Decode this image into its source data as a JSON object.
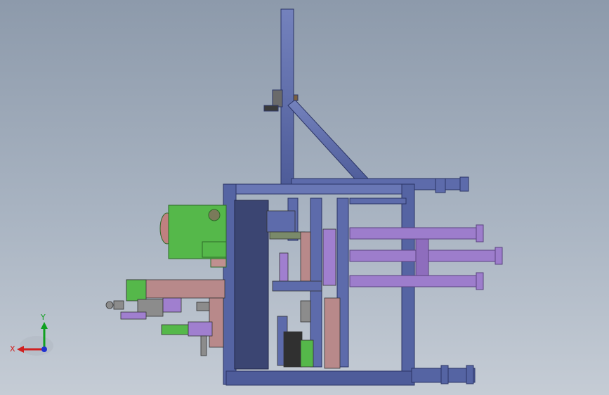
{
  "viewport": {
    "background_top": "#8d9aab",
    "background_bottom": "#c5ccd5"
  },
  "colors": {
    "frame": "#5b6aa6",
    "frame_dark": "#3f4b85",
    "panel": "#3a4470",
    "purple": "#9c7cc9",
    "pink": "#b8898a",
    "green": "#55b84a",
    "gray_part": "#8c8c8c",
    "dark_part": "#303030",
    "axis_x": "#d02020",
    "axis_y": "#10a020",
    "axis_z": "#2030d0"
  },
  "triad": {
    "x_label": "X",
    "y_label": "Y"
  }
}
